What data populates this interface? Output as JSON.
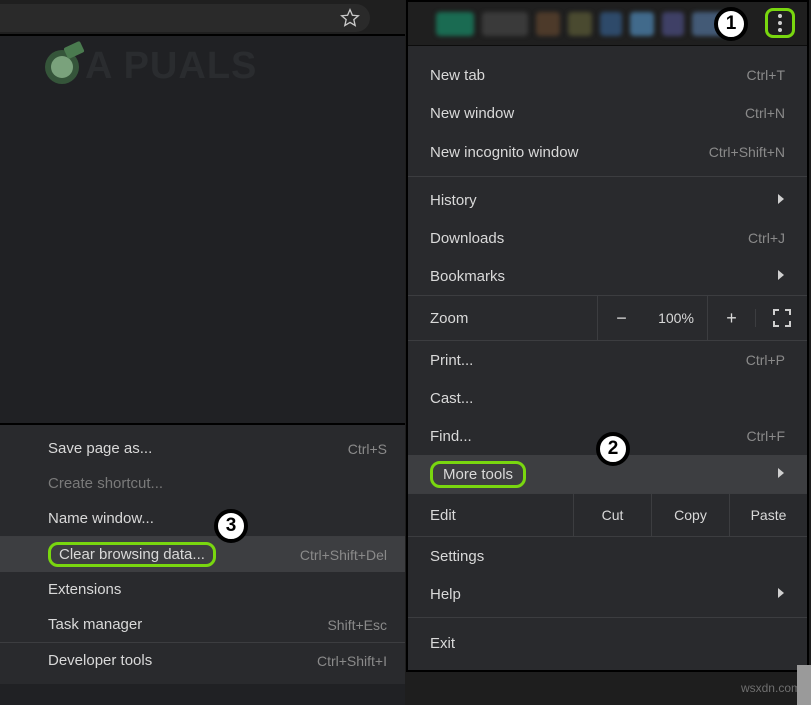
{
  "watermark": "A   PUALS",
  "footer_link": "wsxdn.com",
  "callouts": {
    "one": "1",
    "two": "2",
    "three": "3"
  },
  "main_menu": {
    "new_tab": {
      "label": "New tab",
      "shortcut": "Ctrl+T"
    },
    "new_window": {
      "label": "New window",
      "shortcut": "Ctrl+N"
    },
    "incognito": {
      "label": "New incognito window",
      "shortcut": "Ctrl+Shift+N"
    },
    "history": {
      "label": "History"
    },
    "downloads": {
      "label": "Downloads",
      "shortcut": "Ctrl+J"
    },
    "bookmarks": {
      "label": "Bookmarks"
    },
    "zoom": {
      "label": "Zoom",
      "minus": "−",
      "value": "100%",
      "plus": "+"
    },
    "print": {
      "label": "Print...",
      "shortcut": "Ctrl+P"
    },
    "cast": {
      "label": "Cast..."
    },
    "find": {
      "label": "Find...",
      "shortcut": "Ctrl+F"
    },
    "more_tools": {
      "label": "More tools"
    },
    "edit": {
      "label": "Edit",
      "cut": "Cut",
      "copy": "Copy",
      "paste": "Paste"
    },
    "settings": {
      "label": "Settings"
    },
    "help": {
      "label": "Help"
    },
    "exit": {
      "label": "Exit"
    }
  },
  "submenu": {
    "save_page": {
      "label": "Save page as...",
      "shortcut": "Ctrl+S"
    },
    "create_sc": {
      "label": "Create shortcut..."
    },
    "name_win": {
      "label": "Name window..."
    },
    "clear_data": {
      "label": "Clear browsing data...",
      "shortcut": "Ctrl+Shift+Del"
    },
    "extensions": {
      "label": "Extensions"
    },
    "task_mgr": {
      "label": "Task manager",
      "shortcut": "Shift+Esc"
    },
    "dev_tools": {
      "label": "Developer tools",
      "shortcut": "Ctrl+Shift+I"
    }
  }
}
